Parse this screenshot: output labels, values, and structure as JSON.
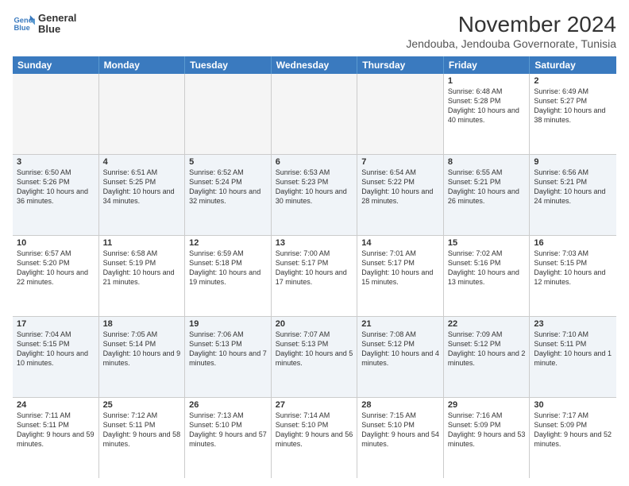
{
  "logo": {
    "line1": "General",
    "line2": "Blue"
  },
  "title": "November 2024",
  "subtitle": "Jendouba, Jendouba Governorate, Tunisia",
  "days_of_week": [
    "Sunday",
    "Monday",
    "Tuesday",
    "Wednesday",
    "Thursday",
    "Friday",
    "Saturday"
  ],
  "rows": [
    {
      "alt": false,
      "cells": [
        {
          "day": "",
          "info": ""
        },
        {
          "day": "",
          "info": ""
        },
        {
          "day": "",
          "info": ""
        },
        {
          "day": "",
          "info": ""
        },
        {
          "day": "",
          "info": ""
        },
        {
          "day": "1",
          "info": "Sunrise: 6:48 AM\nSunset: 5:28 PM\nDaylight: 10 hours and 40 minutes."
        },
        {
          "day": "2",
          "info": "Sunrise: 6:49 AM\nSunset: 5:27 PM\nDaylight: 10 hours and 38 minutes."
        }
      ]
    },
    {
      "alt": true,
      "cells": [
        {
          "day": "3",
          "info": "Sunrise: 6:50 AM\nSunset: 5:26 PM\nDaylight: 10 hours and 36 minutes."
        },
        {
          "day": "4",
          "info": "Sunrise: 6:51 AM\nSunset: 5:25 PM\nDaylight: 10 hours and 34 minutes."
        },
        {
          "day": "5",
          "info": "Sunrise: 6:52 AM\nSunset: 5:24 PM\nDaylight: 10 hours and 32 minutes."
        },
        {
          "day": "6",
          "info": "Sunrise: 6:53 AM\nSunset: 5:23 PM\nDaylight: 10 hours and 30 minutes."
        },
        {
          "day": "7",
          "info": "Sunrise: 6:54 AM\nSunset: 5:22 PM\nDaylight: 10 hours and 28 minutes."
        },
        {
          "day": "8",
          "info": "Sunrise: 6:55 AM\nSunset: 5:21 PM\nDaylight: 10 hours and 26 minutes."
        },
        {
          "day": "9",
          "info": "Sunrise: 6:56 AM\nSunset: 5:21 PM\nDaylight: 10 hours and 24 minutes."
        }
      ]
    },
    {
      "alt": false,
      "cells": [
        {
          "day": "10",
          "info": "Sunrise: 6:57 AM\nSunset: 5:20 PM\nDaylight: 10 hours and 22 minutes."
        },
        {
          "day": "11",
          "info": "Sunrise: 6:58 AM\nSunset: 5:19 PM\nDaylight: 10 hours and 21 minutes."
        },
        {
          "day": "12",
          "info": "Sunrise: 6:59 AM\nSunset: 5:18 PM\nDaylight: 10 hours and 19 minutes."
        },
        {
          "day": "13",
          "info": "Sunrise: 7:00 AM\nSunset: 5:17 PM\nDaylight: 10 hours and 17 minutes."
        },
        {
          "day": "14",
          "info": "Sunrise: 7:01 AM\nSunset: 5:17 PM\nDaylight: 10 hours and 15 minutes."
        },
        {
          "day": "15",
          "info": "Sunrise: 7:02 AM\nSunset: 5:16 PM\nDaylight: 10 hours and 13 minutes."
        },
        {
          "day": "16",
          "info": "Sunrise: 7:03 AM\nSunset: 5:15 PM\nDaylight: 10 hours and 12 minutes."
        }
      ]
    },
    {
      "alt": true,
      "cells": [
        {
          "day": "17",
          "info": "Sunrise: 7:04 AM\nSunset: 5:15 PM\nDaylight: 10 hours and 10 minutes."
        },
        {
          "day": "18",
          "info": "Sunrise: 7:05 AM\nSunset: 5:14 PM\nDaylight: 10 hours and 9 minutes."
        },
        {
          "day": "19",
          "info": "Sunrise: 7:06 AM\nSunset: 5:13 PM\nDaylight: 10 hours and 7 minutes."
        },
        {
          "day": "20",
          "info": "Sunrise: 7:07 AM\nSunset: 5:13 PM\nDaylight: 10 hours and 5 minutes."
        },
        {
          "day": "21",
          "info": "Sunrise: 7:08 AM\nSunset: 5:12 PM\nDaylight: 10 hours and 4 minutes."
        },
        {
          "day": "22",
          "info": "Sunrise: 7:09 AM\nSunset: 5:12 PM\nDaylight: 10 hours and 2 minutes."
        },
        {
          "day": "23",
          "info": "Sunrise: 7:10 AM\nSunset: 5:11 PM\nDaylight: 10 hours and 1 minute."
        }
      ]
    },
    {
      "alt": false,
      "cells": [
        {
          "day": "24",
          "info": "Sunrise: 7:11 AM\nSunset: 5:11 PM\nDaylight: 9 hours and 59 minutes."
        },
        {
          "day": "25",
          "info": "Sunrise: 7:12 AM\nSunset: 5:11 PM\nDaylight: 9 hours and 58 minutes."
        },
        {
          "day": "26",
          "info": "Sunrise: 7:13 AM\nSunset: 5:10 PM\nDaylight: 9 hours and 57 minutes."
        },
        {
          "day": "27",
          "info": "Sunrise: 7:14 AM\nSunset: 5:10 PM\nDaylight: 9 hours and 56 minutes."
        },
        {
          "day": "28",
          "info": "Sunrise: 7:15 AM\nSunset: 5:10 PM\nDaylight: 9 hours and 54 minutes."
        },
        {
          "day": "29",
          "info": "Sunrise: 7:16 AM\nSunset: 5:09 PM\nDaylight: 9 hours and 53 minutes."
        },
        {
          "day": "30",
          "info": "Sunrise: 7:17 AM\nSunset: 5:09 PM\nDaylight: 9 hours and 52 minutes."
        }
      ]
    }
  ]
}
